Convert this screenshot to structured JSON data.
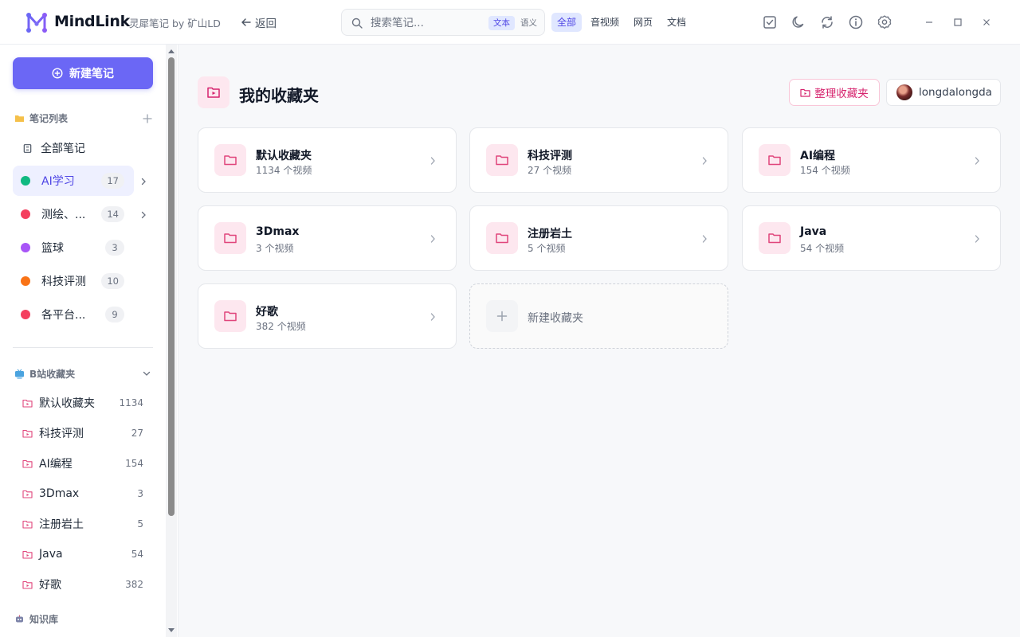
{
  "app": {
    "brand": "MindLink",
    "subtitle": "灵犀笔记 by 矿山LD",
    "back_label": "返回"
  },
  "search": {
    "placeholder": "搜索笔记...",
    "mode_text": "文本",
    "mode_semantic": "语义",
    "filters": [
      "全部",
      "音视频",
      "网页",
      "文档"
    ],
    "active_filter": "全部"
  },
  "sidebar": {
    "new_note_label": "新建笔记",
    "notes_section_label": "笔记列表",
    "all_notes_label": "全部笔记",
    "categories": [
      {
        "label": "AI学习",
        "count": "17",
        "color": "#10b981",
        "active": true
      },
      {
        "label": "测绘、...",
        "count": "14",
        "color": "#f43f5e",
        "active": false
      },
      {
        "label": "篮球",
        "count": "3",
        "color": "#a855f7",
        "active": false
      },
      {
        "label": "科技评测",
        "count": "10",
        "color": "#f97316",
        "active": false
      },
      {
        "label": "各平台...",
        "count": "9",
        "color": "#f43f5e",
        "active": false
      }
    ],
    "bili_section_label": "B站收藏夹",
    "bili_folders": [
      {
        "label": "默认收藏夹",
        "count": "1134"
      },
      {
        "label": "科技评测",
        "count": "27"
      },
      {
        "label": "AI编程",
        "count": "154"
      },
      {
        "label": "3Dmax",
        "count": "3"
      },
      {
        "label": "注册岩土",
        "count": "5"
      },
      {
        "label": "Java",
        "count": "54"
      },
      {
        "label": "好歌",
        "count": "382"
      }
    ],
    "kb_section_label": "知识库"
  },
  "main": {
    "title": "我的收藏夹",
    "organize_label": "整理收藏夹",
    "username": "longdalongda",
    "folders": [
      {
        "name": "默认收藏夹",
        "sub": "1134 个视频"
      },
      {
        "name": "科技评测",
        "sub": "27 个视频"
      },
      {
        "name": "AI编程",
        "sub": "154 个视频"
      },
      {
        "name": "3Dmax",
        "sub": "3 个视频"
      },
      {
        "name": "注册岩土",
        "sub": "5 个视频"
      },
      {
        "name": "Java",
        "sub": "54 个视频"
      },
      {
        "name": "好歌",
        "sub": "382 个视频"
      }
    ],
    "new_folder_label": "新建收藏夹"
  },
  "colors": {
    "accent": "#6b67f5",
    "pink": "#d6246e",
    "pink_bg": "#fde7ef"
  },
  "icons": [
    "back-arrow-icon",
    "search-icon",
    "checkbox-icon",
    "moon-icon",
    "refresh-icon",
    "info-icon",
    "gear-icon",
    "minimize-icon",
    "maximize-icon",
    "close-icon",
    "folder-icon",
    "video-folder-icon",
    "chevron-right-icon",
    "plus-icon",
    "tv-icon",
    "robot-icon"
  ]
}
